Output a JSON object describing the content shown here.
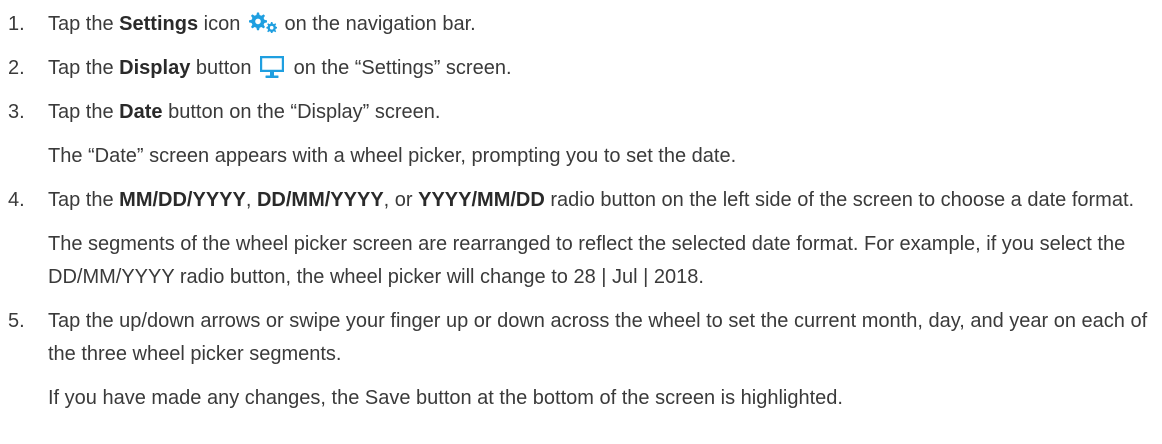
{
  "steps": [
    {
      "number": "1.",
      "lines": [
        [
          "Tap the ",
          "Settings",
          " icon ",
          " on the navigation bar."
        ]
      ],
      "icon": "gear-icon"
    },
    {
      "number": "2.",
      "lines": [
        [
          "Tap the ",
          "Display",
          " button ",
          " on the “Settings” screen."
        ]
      ],
      "icon": "monitor-icon"
    },
    {
      "number": "3.",
      "a": "Tap the ",
      "b": "Date",
      "c": " button on the “Display” screen.",
      "note": "The “Date” screen appears with a wheel picker, prompting you to set the date."
    },
    {
      "number": "4.",
      "a": "Tap the ",
      "b1": "MM/DD/YYYY",
      "s1": ", ",
      "b2": "DD/MM/YYYY",
      "s2": ", or ",
      "b3": "YYYY/MM/DD",
      "c": " radio button on the left side of the screen to choose a date format.",
      "note": "The segments of the wheel picker screen are rearranged to reflect the selected date format. For example, if you select the DD/MM/YYYY radio button, the wheel picker will change to 28 | Jul | 2018."
    },
    {
      "number": "5.",
      "text": "Tap the up/down arrows or swipe your finger up or down across the wheel to set the current month, day, and year on each of the three wheel picker segments.",
      "note": "If you have made any changes, the Save button at the bottom of the screen is highlighted."
    }
  ],
  "colors": {
    "icon_blue": "#1f9fe0",
    "text": "#3a3a3a"
  }
}
